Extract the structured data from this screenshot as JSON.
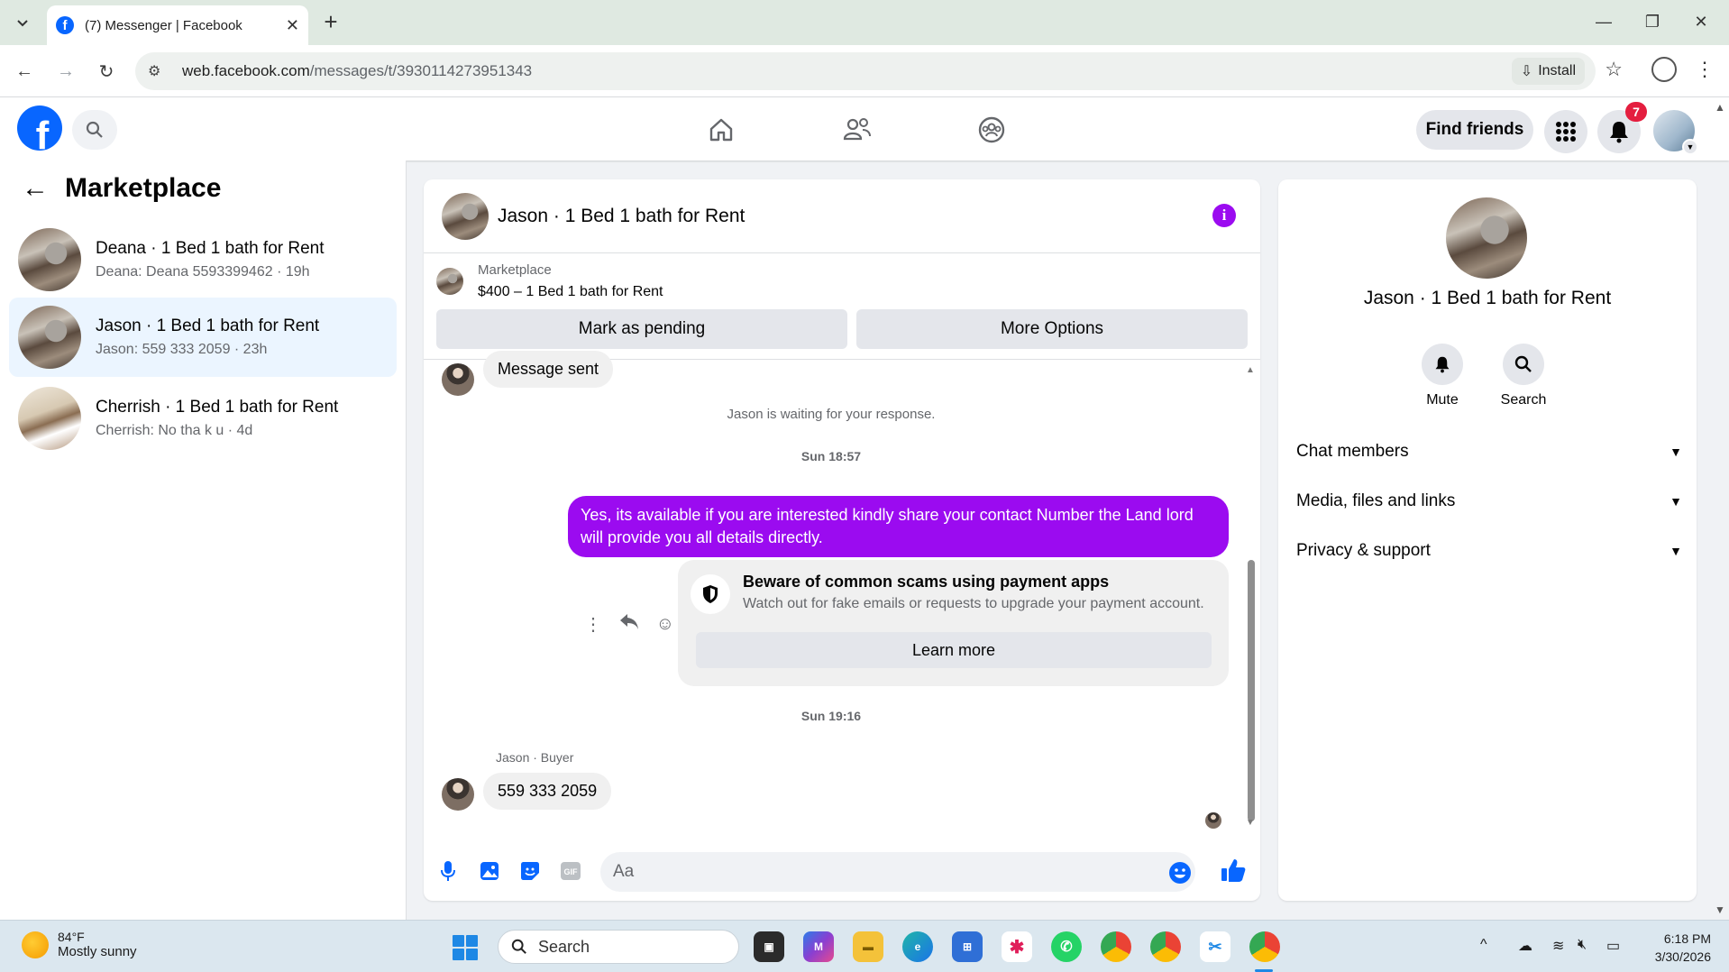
{
  "browser": {
    "tab_title": "(7) Messenger | Facebook",
    "url_host": "web.facebook.com",
    "url_path": "/messages/t/3930114273951343",
    "install_label": "Install"
  },
  "fb_nav": {
    "find_friends_label": "Find friends",
    "notification_count": "7",
    "brand_color": "#0866ff"
  },
  "sidebar": {
    "title": "Marketplace",
    "conversations": [
      {
        "name": "Deana · 1 Bed 1 bath for Rent",
        "preview": "Deana: Deana 5593399462 · 19h"
      },
      {
        "name": "Jason · 1 Bed 1 bath for Rent",
        "preview": "Jason: 559 333 2059 · 23h"
      },
      {
        "name": "Cherrish · 1 Bed 1 bath for Rent",
        "preview": "Cherrish: No tha k u · 4d"
      }
    ]
  },
  "chat": {
    "title": "Jason · 1 Bed 1 bath for Rent",
    "listing_tag": "Marketplace",
    "listing_line": "$400 – 1 Bed 1 bath for Rent",
    "mark_pending_label": "Mark as pending",
    "more_options_label": "More Options",
    "messages": {
      "first_in": "Message sent",
      "waiting_note": "Jason is waiting for your response.",
      "time1": "Sun 18:57",
      "out_text": "Yes, its available if you are interested kindly share your contact Number the Land lord will provide you all details directly.",
      "scam_title": "Beware of common scams using payment apps",
      "scam_desc": "Watch out for fake emails or requests to upgrade your payment account.",
      "learn_more": "Learn more",
      "time2": "Sun 19:16",
      "sender_label": "Jason · Buyer",
      "last_in": "559 333 2059"
    },
    "composer_placeholder": "Aa",
    "accent_color": "#9b0bf0"
  },
  "info_panel": {
    "name": "Jason · 1 Bed 1 bath for Rent",
    "mute_label": "Mute",
    "search_label": "Search",
    "sections": [
      "Chat members",
      "Media, files and links",
      "Privacy & support"
    ]
  },
  "taskbar": {
    "temp": "84°F",
    "weather": "Mostly sunny",
    "search_label": "Search",
    "time": "6:18 PM",
    "date": "3/30/2026"
  }
}
